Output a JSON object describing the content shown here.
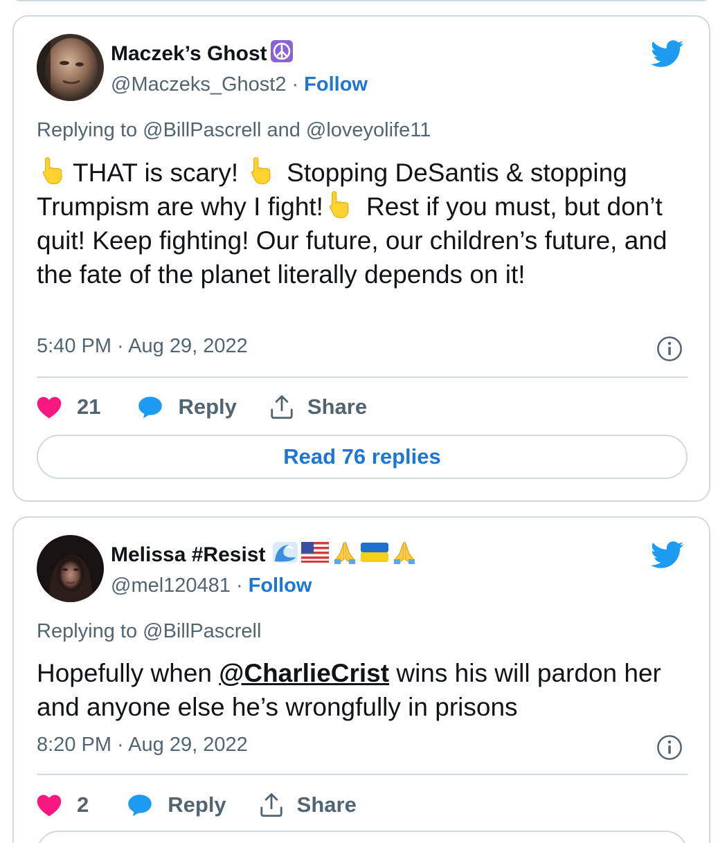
{
  "tweets": [
    {
      "display_name": "Maczek’s Ghost",
      "name_badges": [
        "peace-symbol"
      ],
      "handle": "@Maczeks_Ghost2",
      "separator": "·",
      "follow_label": "Follow",
      "reply_context": "Replying to @BillPascrell and @loveyolife11",
      "text_parts": [
        "THAT is scary!",
        "Stopping DeSantis & stopping Trumpism are why I fight!",
        "Rest if you must, but don’t quit! Keep fighting! Our future, our children’s future, and the fate of the planet literally depends on it!"
      ],
      "timestamp": "5:40 PM · Aug 29, 2022",
      "like_count": "21",
      "reply_label": "Reply",
      "share_label": "Share",
      "read_replies_label": "Read 76 replies"
    },
    {
      "display_name": "Melissa #Resist",
      "name_badges": [
        "water-wave",
        "us-flag",
        "folded-hands",
        "ukraine-flag",
        "folded-hands"
      ],
      "handle": "@mel120481",
      "separator": "·",
      "follow_label": "Follow",
      "reply_context": "Replying to @BillPascrell",
      "text_before_mention": "Hopefully when ",
      "mention": "@CharlieCrist",
      "text_after_mention": " wins his will pardon her and anyone else he’s wrongfully in prisons",
      "timestamp": "8:20 PM · Aug 29, 2022",
      "like_count": "2",
      "reply_label": "Reply",
      "share_label": "Share"
    }
  ],
  "icons": {
    "brand": "twitter-bird-icon",
    "like": "heart-icon",
    "reply": "speech-bubble-icon",
    "share": "share-upload-icon",
    "info": "info-icon",
    "emphasis": "backhand-index-pointing-up-emoji"
  },
  "colors": {
    "link_blue": "#1d76d2",
    "twitter_blue": "#1d9bf0",
    "like_pink": "#f91880",
    "muted_text": "#536471",
    "border": "#cfd9de"
  }
}
